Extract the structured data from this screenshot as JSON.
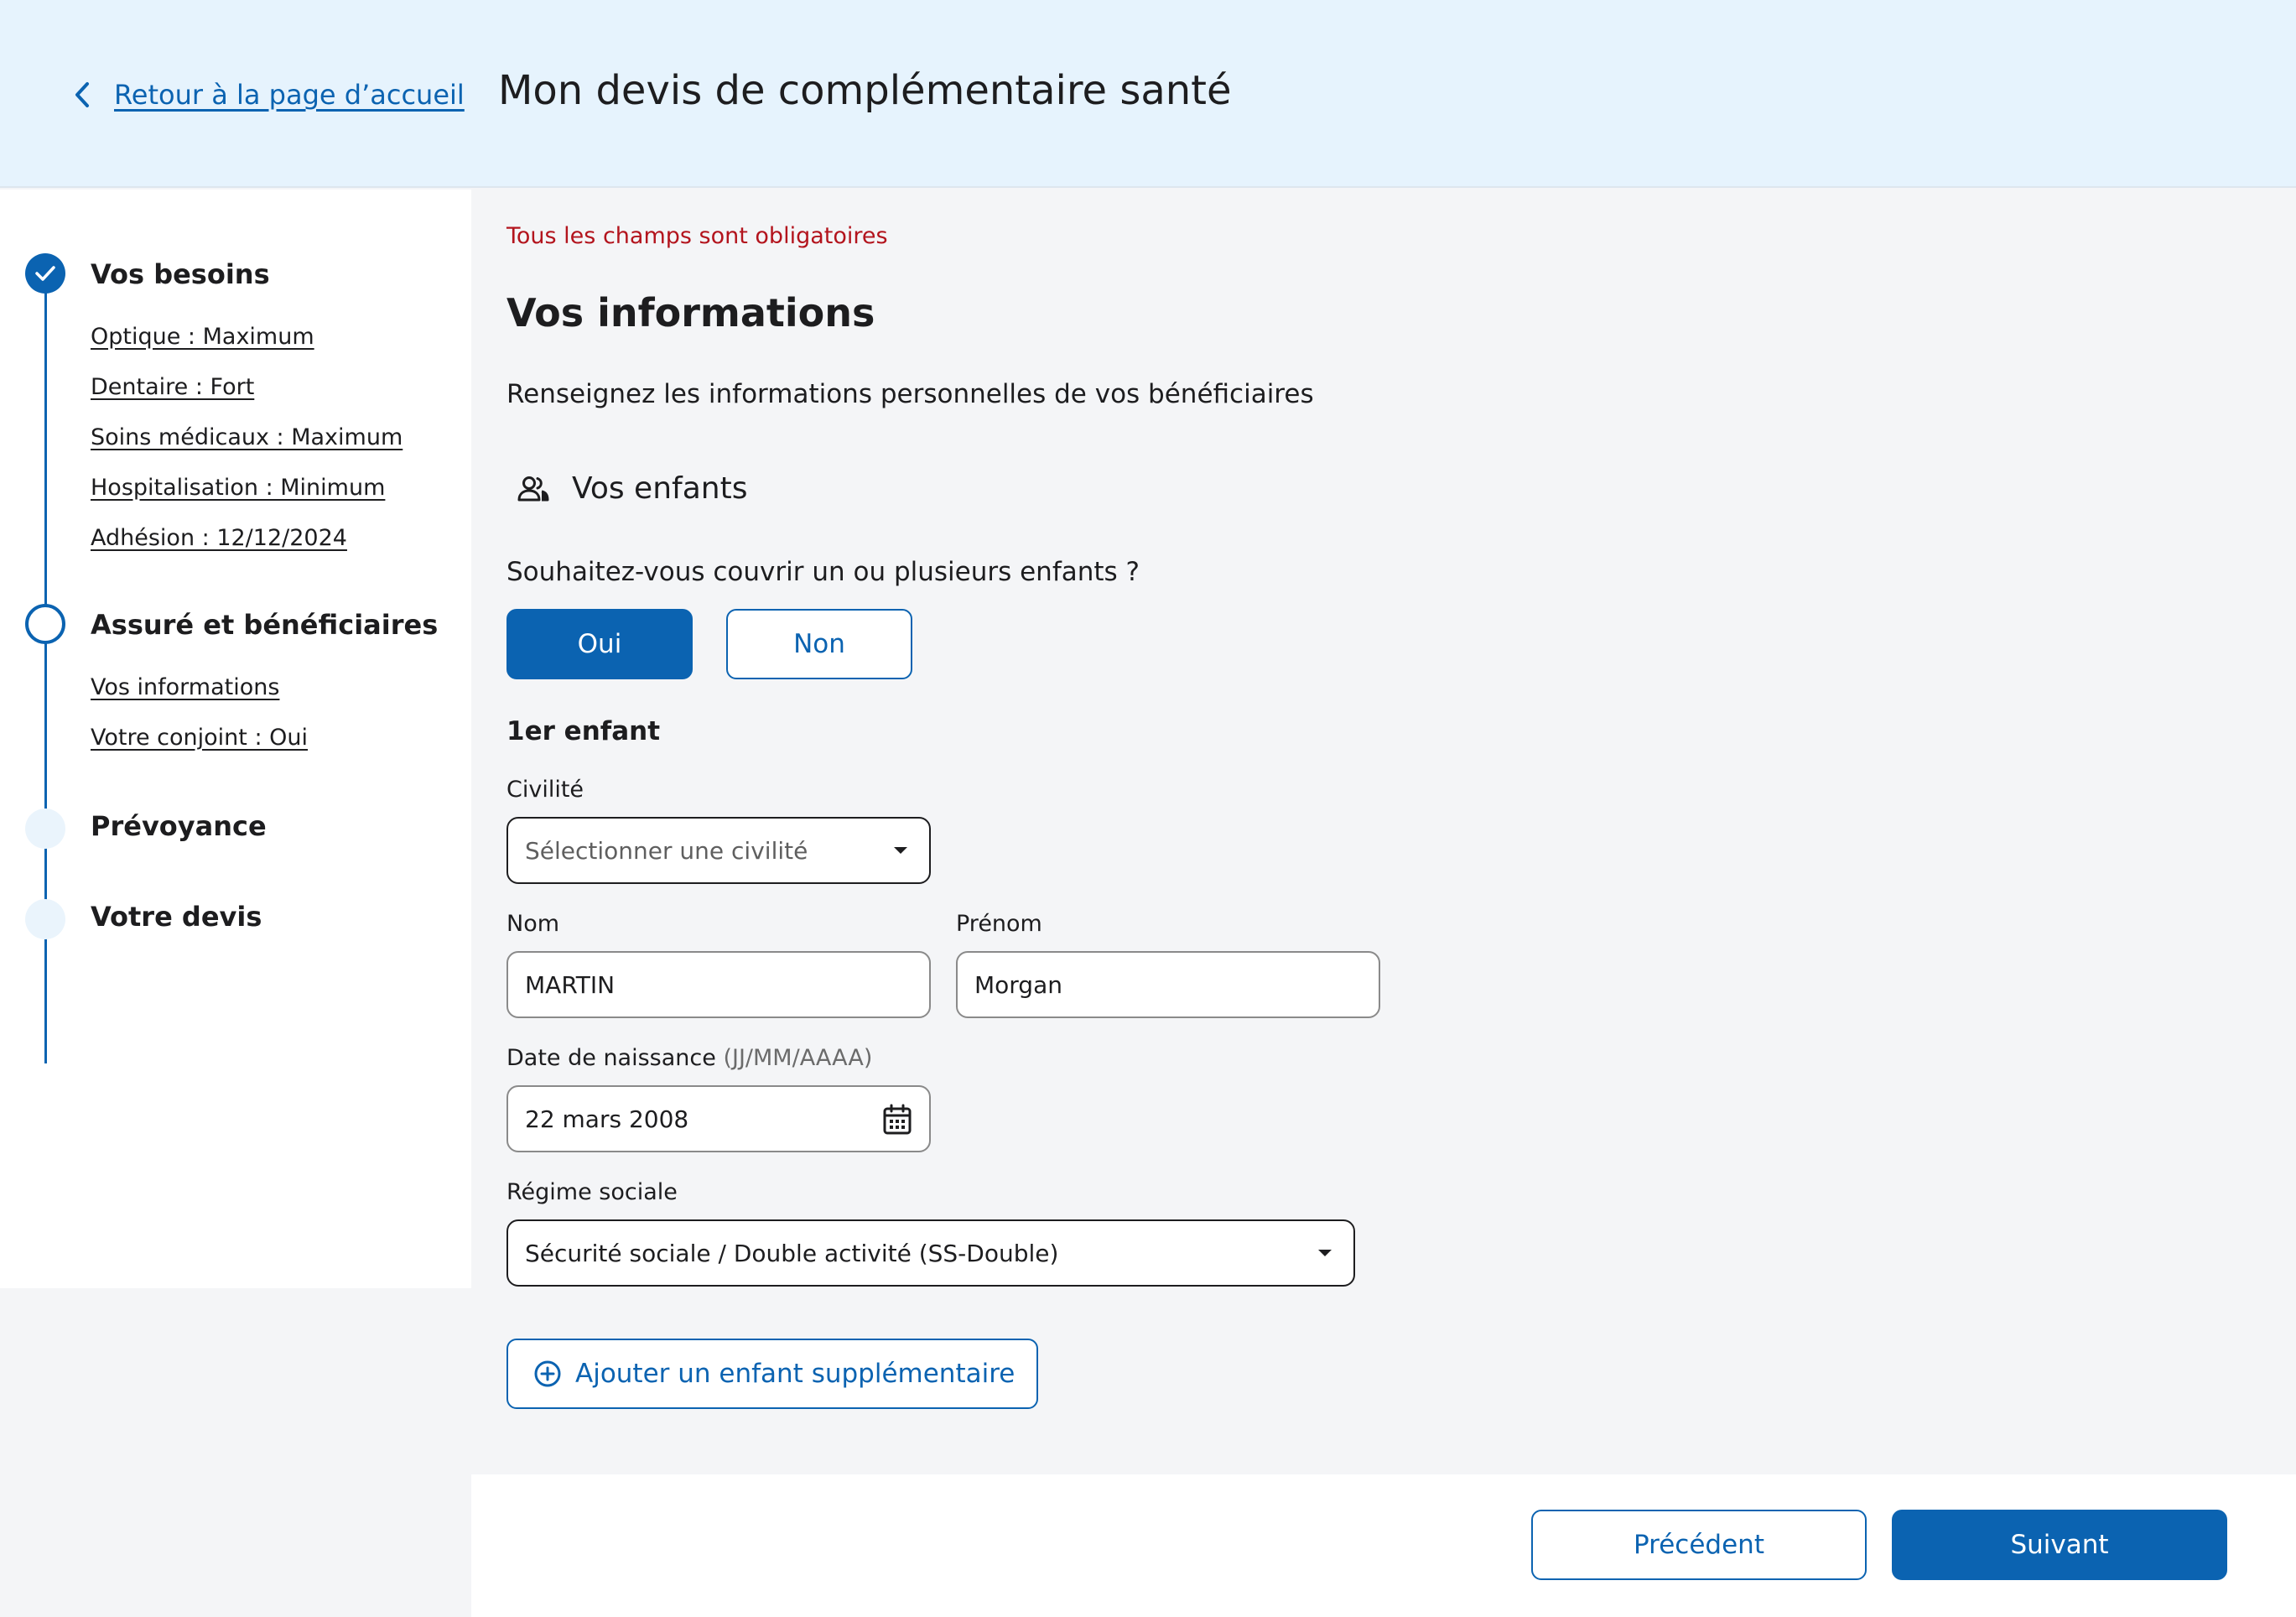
{
  "header": {
    "back_label": "Retour à la page d’accueil",
    "title": "Mon devis de complémentaire santé"
  },
  "sidebar": {
    "steps": [
      {
        "title": "Vos besoins",
        "status": "done",
        "items": [
          "Optique : Maximum",
          "Dentaire : Fort",
          "Soins médicaux : Maximum",
          "Hospitalisation : Minimum",
          "Adhésion : 12/12/2024"
        ]
      },
      {
        "title": "Assuré et bénéficiaires",
        "status": "current",
        "items": [
          "Vos informations",
          "Votre conjoint : Oui"
        ]
      },
      {
        "title": "Prévoyance",
        "status": "todo"
      },
      {
        "title": "Votre devis",
        "status": "todo"
      }
    ]
  },
  "main": {
    "required_note": "Tous les champs sont obligatoires",
    "section_title": "Vos informations",
    "section_desc": "Renseignez les informations personnelles de vos bénéficiaires",
    "children_heading": "Vos enfants",
    "question": "Souhaitez-vous couvrir un ou plusieurs enfants ?",
    "yes_label": "Oui",
    "no_label": "Non",
    "selected": "Oui",
    "child_title": "1er enfant",
    "civility": {
      "label": "Civilité",
      "placeholder": "Sélectionner une civilité"
    },
    "nom": {
      "label": "Nom",
      "value": "MARTIN"
    },
    "prenom": {
      "label": "Prénom",
      "value": "Morgan"
    },
    "birthdate": {
      "label": "Date de naissance",
      "hint": "(JJ/MM/AAAA)",
      "value": "22 mars 2008"
    },
    "regime": {
      "label": "Régime sociale",
      "value": "Sécurité sociale / Double activité (SS-Double)"
    },
    "add_child_label": "Ajouter un enfant supplémentaire"
  },
  "footer": {
    "prev_label": "Précédent",
    "next_label": "Suivant"
  },
  "colors": {
    "primary": "#0b63b1",
    "header_bg": "#e6f3fd",
    "error": "#b3141d"
  }
}
